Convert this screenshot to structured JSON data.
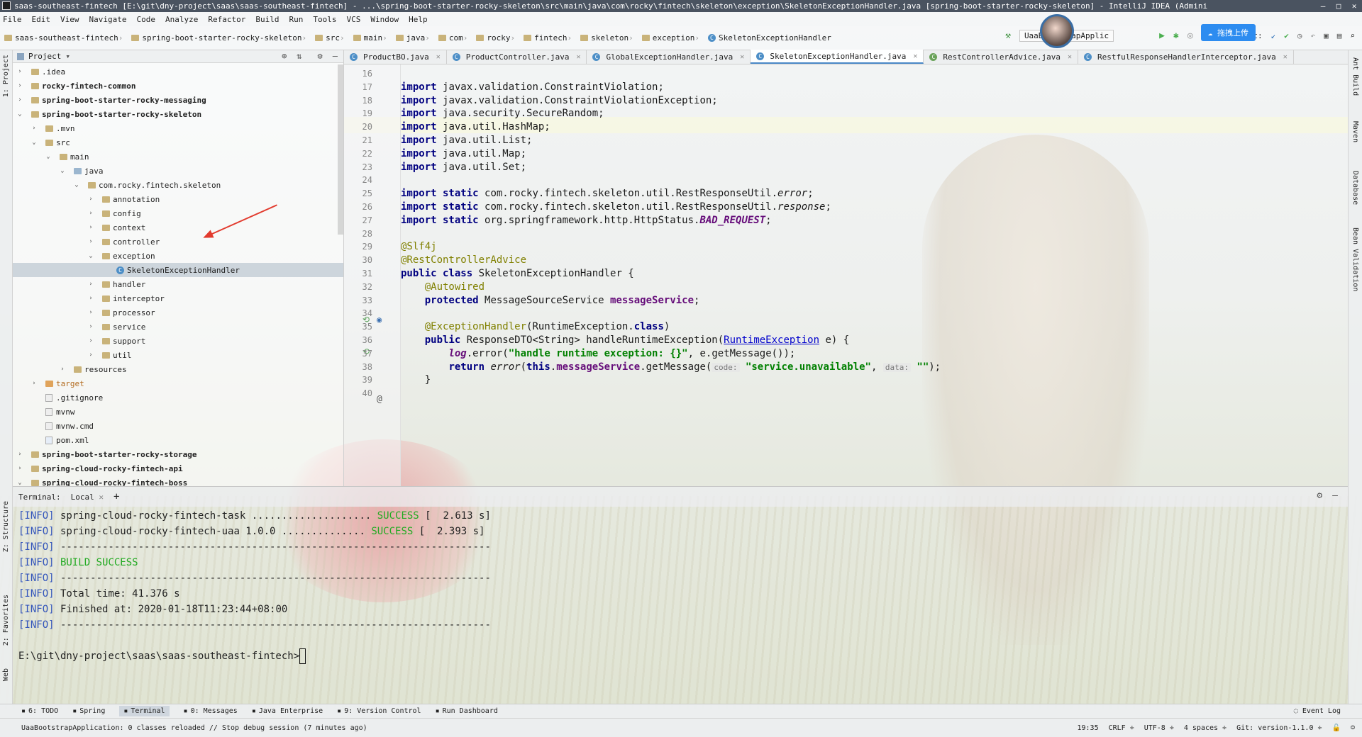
{
  "window": {
    "title": "saas-southeast-fintech [E:\\git\\dny-project\\saas\\saas-southeast-fintech] - ...\\spring-boot-starter-rocky-skeleton\\src\\main\\java\\com\\rocky\\fintech\\skeleton\\exception\\SkeletonExceptionHandler.java [spring-boot-starter-rocky-skeleton] - IntelliJ IDEA (Admini",
    "buttons": [
      "—",
      "□",
      "✕"
    ]
  },
  "menu": [
    "File",
    "Edit",
    "View",
    "Navigate",
    "Code",
    "Analyze",
    "Refactor",
    "Build",
    "Run",
    "Tools",
    "VCS",
    "Window",
    "Help"
  ],
  "breadcrumbs": [
    "saas-southeast-fintech",
    "spring-boot-starter-rocky-skeleton",
    "src",
    "main",
    "java",
    "com",
    "rocky",
    "fintech",
    "skeleton",
    "exception",
    "SkeletonExceptionHandler"
  ],
  "toolbar": {
    "run_config": "UaaBootstrapApplic",
    "git_label": "Git:",
    "upload_label": "拖拽上传"
  },
  "left_strip": {
    "project": "1: Project",
    "structure": "Z: Structure",
    "favorites": "2: Favorites",
    "web": "Web"
  },
  "right_strip": {
    "ant": "Ant Build",
    "maven": "Maven",
    "database": "Database",
    "bean": "Bean Validation"
  },
  "project_panel": {
    "title": "Project",
    "tree": [
      {
        "label": ".idea",
        "depth": 1,
        "arrow": "›",
        "bold": false,
        "icon": "folder"
      },
      {
        "label": "rocky-fintech-common",
        "depth": 1,
        "arrow": "›",
        "bold": true,
        "icon": "folder"
      },
      {
        "label": "spring-boot-starter-rocky-messaging",
        "depth": 1,
        "arrow": "›",
        "bold": true,
        "icon": "folder"
      },
      {
        "label": "spring-boot-starter-rocky-skeleton",
        "depth": 1,
        "arrow": "⌄",
        "bold": true,
        "icon": "folder"
      },
      {
        "label": ".mvn",
        "depth": 2,
        "arrow": "›",
        "bold": false,
        "icon": "folder"
      },
      {
        "label": "src",
        "depth": 2,
        "arrow": "⌄",
        "bold": false,
        "icon": "folder"
      },
      {
        "label": "main",
        "depth": 3,
        "arrow": "⌄",
        "bold": false,
        "icon": "folder"
      },
      {
        "label": "java",
        "depth": 4,
        "arrow": "⌄",
        "bold": false,
        "icon": "folder-blue"
      },
      {
        "label": "com.rocky.fintech.skeleton",
        "depth": 5,
        "arrow": "⌄",
        "bold": false,
        "icon": "folder"
      },
      {
        "label": "annotation",
        "depth": 6,
        "arrow": "›",
        "bold": false,
        "icon": "folder"
      },
      {
        "label": "config",
        "depth": 6,
        "arrow": "›",
        "bold": false,
        "icon": "folder"
      },
      {
        "label": "context",
        "depth": 6,
        "arrow": "›",
        "bold": false,
        "icon": "folder"
      },
      {
        "label": "controller",
        "depth": 6,
        "arrow": "›",
        "bold": false,
        "icon": "folder"
      },
      {
        "label": "exception",
        "depth": 6,
        "arrow": "⌄",
        "bold": false,
        "icon": "folder"
      },
      {
        "label": "SkeletonExceptionHandler",
        "depth": 7,
        "arrow": "",
        "bold": false,
        "icon": "class",
        "selected": true
      },
      {
        "label": "handler",
        "depth": 6,
        "arrow": "›",
        "bold": false,
        "icon": "folder"
      },
      {
        "label": "interceptor",
        "depth": 6,
        "arrow": "›",
        "bold": false,
        "icon": "folder"
      },
      {
        "label": "processor",
        "depth": 6,
        "arrow": "›",
        "bold": false,
        "icon": "folder"
      },
      {
        "label": "service",
        "depth": 6,
        "arrow": "›",
        "bold": false,
        "icon": "folder"
      },
      {
        "label": "support",
        "depth": 6,
        "arrow": "›",
        "bold": false,
        "icon": "folder"
      },
      {
        "label": "util",
        "depth": 6,
        "arrow": "›",
        "bold": false,
        "icon": "folder"
      },
      {
        "label": "resources",
        "depth": 4,
        "arrow": "›",
        "bold": false,
        "icon": "folder"
      },
      {
        "label": "target",
        "depth": 2,
        "arrow": "›",
        "bold": false,
        "icon": "folder-orange"
      },
      {
        "label": ".gitignore",
        "depth": 2,
        "arrow": "",
        "bold": false,
        "icon": "file"
      },
      {
        "label": "mvnw",
        "depth": 2,
        "arrow": "",
        "bold": false,
        "icon": "file"
      },
      {
        "label": "mvnw.cmd",
        "depth": 2,
        "arrow": "",
        "bold": false,
        "icon": "file"
      },
      {
        "label": "pom.xml",
        "depth": 2,
        "arrow": "",
        "bold": false,
        "icon": "maven"
      },
      {
        "label": "spring-boot-starter-rocky-storage",
        "depth": 1,
        "arrow": "›",
        "bold": true,
        "icon": "folder"
      },
      {
        "label": "spring-cloud-rocky-fintech-api",
        "depth": 1,
        "arrow": "›",
        "bold": true,
        "icon": "folder"
      },
      {
        "label": "spring-cloud-rocky-fintech-boss",
        "depth": 1,
        "arrow": "⌄",
        "bold": true,
        "icon": "folder"
      }
    ]
  },
  "tabs": [
    {
      "label": "ProductBO.java",
      "active": false
    },
    {
      "label": "ProductController.java",
      "active": false
    },
    {
      "label": "GlobalExceptionHandler.java",
      "active": false
    },
    {
      "label": "SkeletonExceptionHandler.java",
      "active": true
    },
    {
      "label": "RestControllerAdvice.java",
      "active": false
    },
    {
      "label": "RestfulResponseHandlerInterceptor.java",
      "active": false
    }
  ],
  "editor": {
    "line_numbers": [
      "16",
      "17",
      "18",
      "19",
      "20",
      "21",
      "22",
      "23",
      "24",
      "25",
      "26",
      "27",
      "28",
      "29",
      "30",
      "31",
      "32",
      "33",
      "34",
      "35",
      "36",
      "37",
      "38",
      "39",
      "40"
    ],
    "lines": [
      [],
      [
        [
          "kw",
          "import"
        ],
        [
          "",
          "javax.validation.ConstraintViolation;"
        ]
      ],
      [
        [
          "kw",
          "import"
        ],
        [
          "",
          "javax.validation.ConstraintViolationException;"
        ]
      ],
      [
        [
          "kw",
          "import"
        ],
        [
          "",
          "java.security.SecureRandom;"
        ]
      ],
      [
        [
          "kw",
          "import"
        ],
        [
          "",
          "java.util.HashMap;"
        ]
      ],
      [
        [
          "kw",
          "import"
        ],
        [
          "",
          "java.util.List;"
        ]
      ],
      [
        [
          "kw",
          "import"
        ],
        [
          "",
          "java.util.Map;"
        ]
      ],
      [
        [
          "kw",
          "import"
        ],
        [
          "",
          "java.util.Set;"
        ]
      ],
      [],
      [
        [
          "kw",
          "import static"
        ],
        [
          "",
          "com.rocky.fintech.skeleton.util.RestResponseUtil."
        ],
        [
          "ital",
          "error"
        ],
        [
          "",
          ";"
        ]
      ],
      [
        [
          "kw",
          "import static"
        ],
        [
          "",
          "com.rocky.fintech.skeleton.util.RestResponseUtil."
        ],
        [
          "ital",
          "response"
        ],
        [
          "",
          ";"
        ]
      ],
      [
        [
          "kw",
          "import static"
        ],
        [
          "",
          "org.springframework.http.HttpStatus."
        ],
        [
          "fld ital",
          "BAD_REQUEST"
        ],
        [
          "",
          ";"
        ]
      ],
      [],
      [
        [
          "ann",
          "@Slf4j"
        ]
      ],
      [
        [
          "ann",
          "@RestControllerAdvice"
        ]
      ],
      [
        [
          "kw",
          "public class"
        ],
        [
          "",
          "SkeletonExceptionHandler {"
        ]
      ],
      [
        [
          "",
          "    "
        ],
        [
          "ann",
          "@Autowired"
        ]
      ],
      [
        [
          "",
          "    "
        ],
        [
          "kw",
          "protected"
        ],
        [
          "",
          "MessageSourceService"
        ],
        [
          "fld",
          "messageService"
        ],
        [
          "",
          ";"
        ]
      ],
      [],
      [
        [
          "",
          "    "
        ],
        [
          "ann",
          "@ExceptionHandler"
        ],
        [
          "",
          "(RuntimeException."
        ],
        [
          "kw",
          "class"
        ],
        [
          "",
          ")"
        ]
      ],
      [
        [
          "",
          "    "
        ],
        [
          "kw",
          "public"
        ],
        [
          "",
          "ResponseDTO<String> handleRuntimeException("
        ],
        [
          "link",
          "RuntimeException"
        ],
        [
          "",
          "e) {"
        ]
      ],
      [
        [
          "",
          "        "
        ],
        [
          "fld ital",
          "log"
        ],
        [
          "",
          ".error("
        ],
        [
          "str",
          "\"handle runtime exception: {}\""
        ],
        [
          "",
          ", e.getMessage());"
        ]
      ],
      [
        [
          "",
          "        "
        ],
        [
          "kw",
          "return"
        ],
        [
          "ital",
          "error"
        ],
        [
          "",
          "("
        ],
        [
          "kw",
          "this"
        ],
        [
          "",
          "."
        ],
        [
          "fld",
          "messageService"
        ],
        [
          "",
          ".getMessage("
        ],
        [
          "hint",
          "code:"
        ],
        [
          "str",
          "\"service.unavailable\""
        ],
        [
          "",
          ","
        ],
        [
          "hint",
          "data:"
        ],
        [
          "str",
          "\"\""
        ],
        [
          "",
          ");"
        ]
      ],
      [
        [
          "",
          "    }"
        ]
      ],
      []
    ]
  },
  "terminal": {
    "header": {
      "title": "Terminal:",
      "tab": "Local",
      "add": "+"
    },
    "lines": [
      {
        "parts": [
          [
            "info",
            "[INFO]"
          ],
          [
            "",
            " spring-cloud-rocky-fintech-task .................... "
          ],
          [
            "succ",
            "SUCCESS"
          ],
          [
            "",
            " [  2.613 s]"
          ]
        ]
      },
      {
        "parts": [
          [
            "info",
            "[INFO]"
          ],
          [
            "",
            " spring-cloud-rocky-fintech-uaa 1.0.0 .............. "
          ],
          [
            "succ",
            "SUCCESS"
          ],
          [
            "",
            " [  2.393 s]"
          ]
        ]
      },
      {
        "parts": [
          [
            "info",
            "[INFO]"
          ],
          [
            "",
            " ------------------------------------------------------------------------"
          ]
        ]
      },
      {
        "parts": [
          [
            "info",
            "[INFO]"
          ],
          [
            "succ",
            " BUILD SUCCESS"
          ]
        ]
      },
      {
        "parts": [
          [
            "info",
            "[INFO]"
          ],
          [
            "",
            " ------------------------------------------------------------------------"
          ]
        ]
      },
      {
        "parts": [
          [
            "info",
            "[INFO]"
          ],
          [
            "",
            " Total time: 41.376 s"
          ]
        ]
      },
      {
        "parts": [
          [
            "info",
            "[INFO]"
          ],
          [
            "",
            " Finished at: 2020-01-18T11:23:44+08:00"
          ]
        ]
      },
      {
        "parts": [
          [
            "info",
            "[INFO]"
          ],
          [
            "",
            " ------------------------------------------------------------------------"
          ]
        ]
      },
      {
        "parts": []
      },
      {
        "parts": [
          [
            "",
            "E:\\git\\dny-project\\saas\\saas-southeast-fintech>"
          ]
        ],
        "cursor": true
      }
    ]
  },
  "bottom_tools": [
    {
      "label": "6: TODO",
      "active": false
    },
    {
      "label": "Spring",
      "active": false
    },
    {
      "label": "Terminal",
      "active": true
    },
    {
      "label": "0: Messages",
      "active": false
    },
    {
      "label": "Java Enterprise",
      "active": false
    },
    {
      "label": "9: Version Control",
      "active": false
    },
    {
      "label": "Run Dashboard",
      "active": false
    }
  ],
  "event_log": "Event Log",
  "status": {
    "message": "UaaBootstrapApplication: 0 classes reloaded // Stop debug session (7 minutes ago)",
    "position": "19:35",
    "line_sep": "CRLF ÷",
    "encoding": "UTF-8 ÷",
    "indent": "4 spaces ÷",
    "vcs": "Git: version-1.1.0 ÷"
  }
}
